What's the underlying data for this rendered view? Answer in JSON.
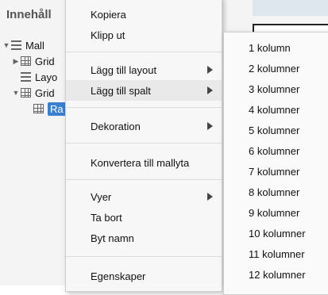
{
  "panel": {
    "title": "Innehåll",
    "tree": [
      {
        "label": "Mall",
        "icon": "list-icon",
        "expanded": true
      },
      {
        "label": "Grid",
        "icon": "grid-icon",
        "expanded": false
      },
      {
        "label": "Layo",
        "icon": "list-icon"
      },
      {
        "label": "Grid",
        "icon": "grid-icon",
        "expanded": true
      },
      {
        "label": "Ra",
        "icon": "grid-icon",
        "selected": true
      }
    ]
  },
  "context_menu": {
    "items": [
      {
        "label": "Kopiera"
      },
      {
        "label": "Klipp ut"
      },
      {
        "label": "Lägg till layout",
        "submenu": true
      },
      {
        "label": "Lägg till spalt",
        "submenu": true,
        "active": true
      },
      {
        "label": "Dekoration",
        "submenu": true
      },
      {
        "label": "Konvertera till mallyta"
      },
      {
        "label": "Vyer",
        "submenu": true
      },
      {
        "label": "Ta bort"
      },
      {
        "label": "Byt namn"
      },
      {
        "label": "Egenskaper"
      }
    ]
  },
  "column_submenu": {
    "items": [
      "1 kolumn",
      "2 kolumner",
      "3 kolumner",
      "4 kolumner",
      "5 kolumner",
      "6 kolumner",
      "7 kolumner",
      "8 kolumner",
      "9 kolumner",
      "10 kolumner",
      "11 kolumner",
      "12 kolumner"
    ]
  },
  "colors": {
    "selection": "#3a7fd0",
    "menu_bg": "#f7f7f7",
    "active_item": "#e9e9e9"
  }
}
